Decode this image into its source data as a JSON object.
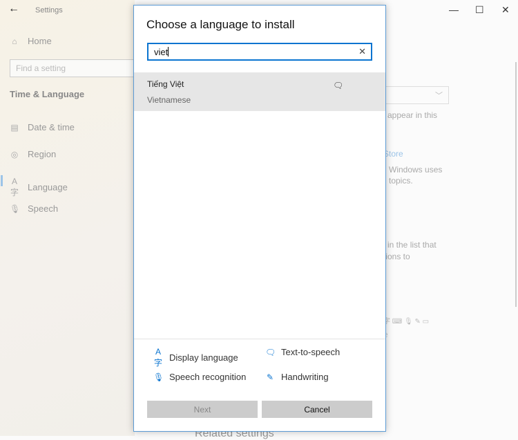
{
  "settings": {
    "title": "Settings",
    "home": "Home",
    "search_placeholder": "Find a setting",
    "section": "Time & Language",
    "nav": [
      {
        "label": "Date & time",
        "icon": "calendar-clock-icon"
      },
      {
        "label": "Region",
        "icon": "globe-icon"
      },
      {
        "label": "Language",
        "icon": "language-icon"
      },
      {
        "label": "Speech",
        "icon": "microphone-icon"
      }
    ],
    "background_text": [
      "l appear in this",
      "Store",
      "Windows uses",
      "topics.",
      "in the list that",
      "tions to",
      "e",
      "Related settings"
    ]
  },
  "dialog": {
    "title": "Choose a language to install",
    "search_value": "viet",
    "results": [
      {
        "native": "Tiếng Việt",
        "english": "Vietnamese",
        "features": [
          "text-to-speech-icon"
        ]
      }
    ],
    "legend": [
      {
        "label": "Display language",
        "icon": "language-icon"
      },
      {
        "label": "Text-to-speech",
        "icon": "text-to-speech-icon"
      },
      {
        "label": "Speech recognition",
        "icon": "microphone-icon"
      },
      {
        "label": "Handwriting",
        "icon": "handwriting-icon"
      }
    ],
    "next": "Next",
    "cancel": "Cancel"
  },
  "colors": {
    "accent": "#0a74d0"
  }
}
